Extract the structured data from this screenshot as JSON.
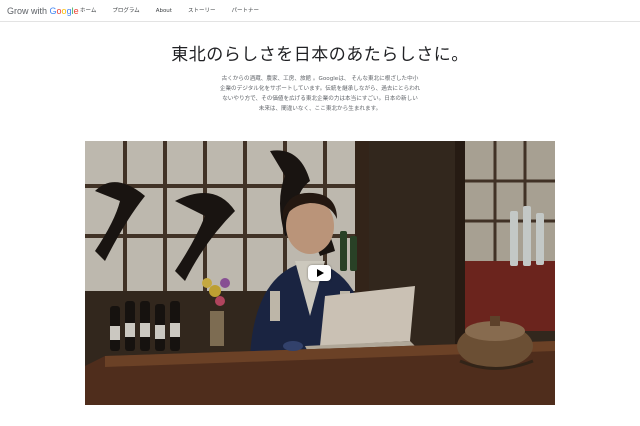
{
  "header": {
    "logo": {
      "part1": "Grow with ",
      "g1": "G",
      "o1": "o",
      "o2": "o",
      "g2": "g",
      "l": "l",
      "e": "e"
    },
    "nav": [
      "ホーム",
      "プログラム",
      "About",
      "ストーリー",
      "パートナー"
    ]
  },
  "hero": {
    "title": "東北のらしさを日本のあたらしさに。",
    "intro_lines": [
      "古くからの酒蔵、農家、工房、旅館 。Googleは、 そんな東北に根ざした中小",
      "企業のデジタル化をサポートしています。伝統を継承しながら、過去にとらわれ",
      "ないやり方で、その価値を広げる東北企業の力は本当にすごい。日本の新しい",
      "未来は、間違いなく、ここ東北から生まれます。"
    ]
  },
  "video": {
    "play_icon": "play-icon",
    "caption": ""
  },
  "colors": {
    "text": "#202124",
    "muted": "#5f6368",
    "google_blue": "#4285f4",
    "google_red": "#ea4335",
    "google_yellow": "#fbbc05",
    "google_green": "#34a853"
  }
}
